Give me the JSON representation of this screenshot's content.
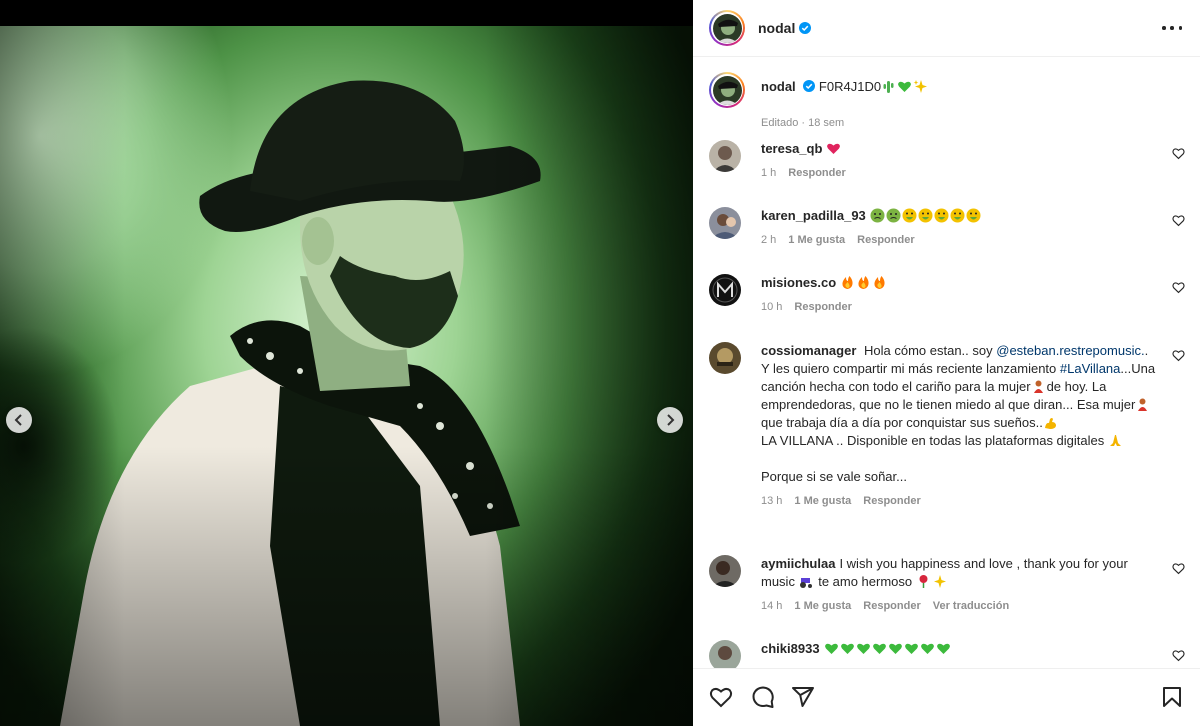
{
  "post": {
    "username": "nodal",
    "caption_text": "F0R4J1D0",
    "caption_meta": "Editado · 18 sem"
  },
  "icons": {
    "verified": "verified-badge-icon",
    "more": "more-options-icon",
    "prev": "chevron-left-icon",
    "next": "chevron-right-icon",
    "like": "heart-icon",
    "comment": "comment-icon",
    "share": "share-icon",
    "save": "bookmark-icon"
  },
  "colors": {
    "verified": "#0095f6",
    "link": "#00376b",
    "muted": "#8e8e8e"
  },
  "comments": [
    {
      "username": "teresa_qb",
      "text_parts": [],
      "time": "1 h",
      "likes": "",
      "reply": "Responder",
      "translate": ""
    },
    {
      "username": "karen_padilla_93",
      "text_parts": [],
      "time": "2 h",
      "likes": "1 Me gusta",
      "reply": "Responder",
      "translate": ""
    },
    {
      "username": "misiones.co",
      "text_parts": [],
      "time": "10 h",
      "likes": "",
      "reply": "Responder",
      "translate": ""
    },
    {
      "username": "cossiomanager",
      "text_a": "Hola cómo estan.. soy",
      "mention": "@esteban.restrepomusic.",
      "text_b": ". Y les quiero compartir mi más reciente lanzamiento",
      "hashtag": "#LaVillana",
      "text_c": "...Una canción hecha con todo el cariño para la mujer",
      "text_d": "de hoy. La emprendedoras, que no le tienen miedo al que diran... Esa mujer",
      "text_e": "que trabaja día a día por conquistar sus sueños..",
      "text_f": "LA VILLANA .. Disponible en todas las plataformas digitales",
      "text_g": "Porque si se vale soñar...",
      "time": "13 h",
      "likes": "1 Me gusta",
      "reply": "Responder",
      "translate": ""
    },
    {
      "username": "aymiichulaa",
      "text_a": "I wish you happiness and love , thank you for your music",
      "text_b": "te amo hermoso",
      "time": "14 h",
      "likes": "1 Me gusta",
      "reply": "Responder",
      "translate": "Ver traducción"
    },
    {
      "username": "chiki8933",
      "time": "",
      "likes": "",
      "reply": "",
      "translate": ""
    }
  ]
}
